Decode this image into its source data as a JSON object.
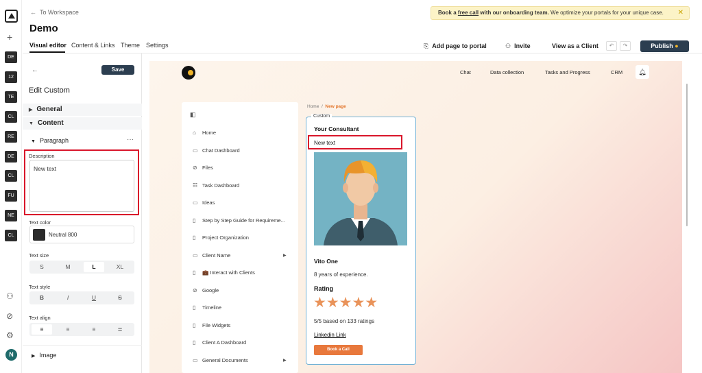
{
  "rail": {
    "chips": [
      "DE",
      "12",
      "TE",
      "CL",
      "RE",
      "DE",
      "CL",
      "FU",
      "NE",
      "CL"
    ],
    "avatar": "N"
  },
  "header": {
    "back_label": "To Workspace",
    "title": "Demo",
    "tabs": [
      "Visual editor",
      "Content & Links",
      "Theme",
      "Settings"
    ],
    "banner": {
      "prefix": "Book a ",
      "link": "free call",
      "middle": " with our onboarding team.",
      "suffix": " We optimize your portals for your unique case."
    },
    "add_page": "Add page to portal",
    "invite": "Invite",
    "view_as_client": "View as a Client",
    "publish": "Publish"
  },
  "panel": {
    "save": "Save",
    "title": "Edit Custom",
    "general": "General",
    "content": "Content",
    "paragraph": "Paragraph",
    "description_label": "Description",
    "description_value": "New text",
    "text_color_label": "Text color",
    "text_color_value": "Neutral 800",
    "text_size_label": "Text size",
    "sizes": [
      "S",
      "M",
      "L",
      "XL"
    ],
    "selected_size": "L",
    "text_style_label": "Text style",
    "styles": [
      "B",
      "I",
      "U",
      "S"
    ],
    "text_align_label": "Text align",
    "image": "Image"
  },
  "canvas": {
    "topnav": [
      "Chat",
      "Data collection",
      "Tasks and Progress",
      "CRM"
    ],
    "nav_items": [
      "Home",
      "Chat Dashboard",
      "Files",
      "Task Dashboard",
      "Ideas",
      "Step by Step Guide for Requireme...",
      "Project Organization",
      "Client Name",
      "💼 Interact with Clients",
      "Google",
      "Timeline",
      "File Widgets",
      "Client A Dashboard",
      "General Documents"
    ],
    "breadcrumb_home": "Home",
    "breadcrumb_sep": "/",
    "breadcrumb_current": "New page",
    "custom_tag": "Custom",
    "consultant_heading": "Your Consultant",
    "new_text": "New text",
    "person_name": "Vito One",
    "experience": "8 years of experience.",
    "rating_label": "Rating",
    "stars": "★★★★★",
    "rating_text": "5/5 based on 133 ratings",
    "linkedin": "Linkedin Link",
    "book_call": "Book a Call"
  },
  "colors": {
    "accent": "#2c3e50",
    "highlight": "#d9152a",
    "orange": "#e8783c",
    "card_border": "#6fb1d6"
  }
}
